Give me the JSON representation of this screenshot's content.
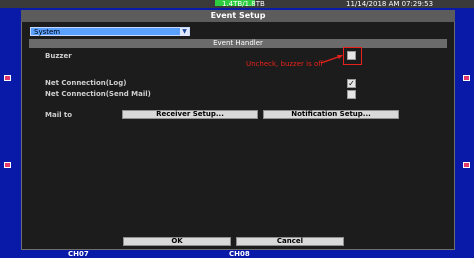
{
  "header": {
    "storage": "1.4TB/1.8TB",
    "datetime": "11/14/2018 AM 07:29:53"
  },
  "dialog": {
    "title": "Event Setup",
    "category_select": "System",
    "section_title": "Event Handler",
    "rows": [
      {
        "label": "Buzzer",
        "checked": false
      },
      {
        "label": "Net Connection(Log)",
        "checked": true
      },
      {
        "label": "Net Connection(Send Mail)",
        "checked": false
      }
    ],
    "mail_label": "Mail to",
    "receiver_button": "Receiver Setup...",
    "notification_button": "Notification Setup...",
    "ok_button": "OK",
    "cancel_button": "Cancel"
  },
  "annotation": {
    "text": "Uncheck, buzzer is off",
    "color": "#e8221a"
  },
  "cameras": {
    "left": "CH07",
    "right": "CH08"
  },
  "colors": {
    "background": "#0a1aa8",
    "dialog": "#1c1c1c",
    "select": "#5aa0ff"
  }
}
